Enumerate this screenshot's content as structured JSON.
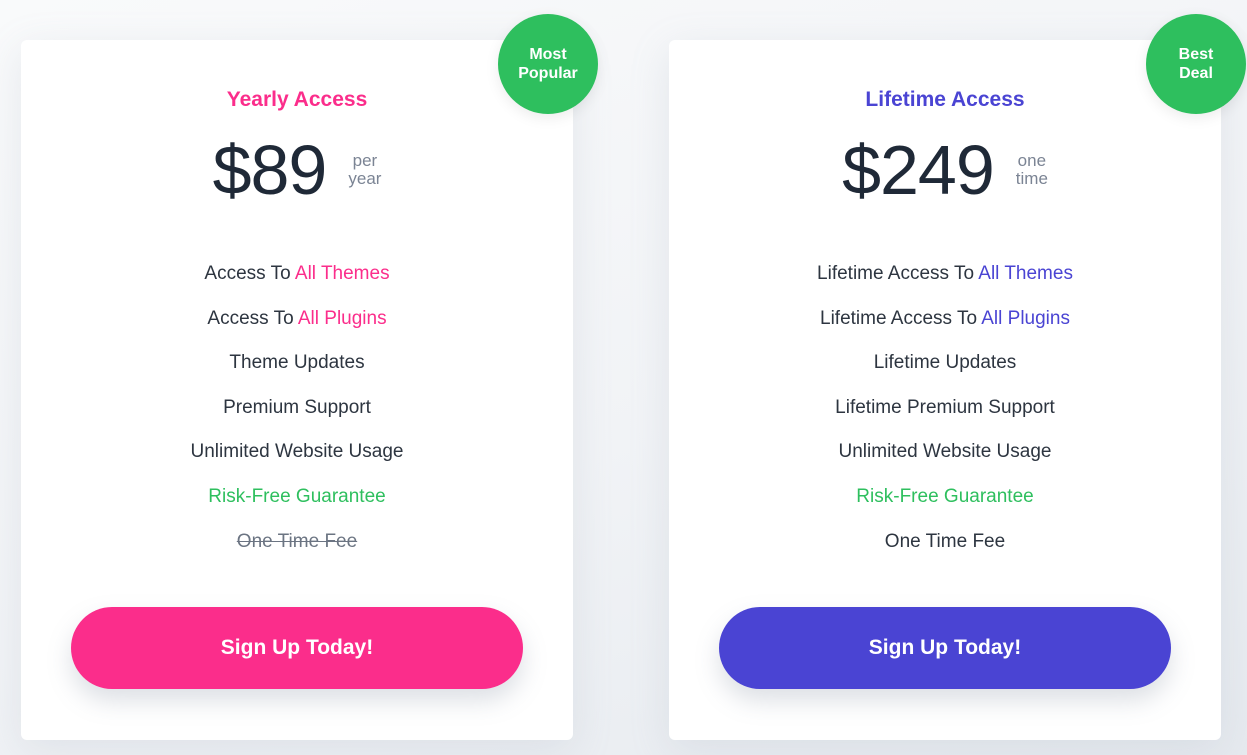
{
  "colors": {
    "yearly_accent": "#fb2d8b",
    "lifetime_accent": "#4a44d3",
    "badge_green": "#2ebf5e",
    "text_dark": "#2d3540"
  },
  "plans": [
    {
      "badge": "Most\nPopular",
      "title": "Yearly Access",
      "price": "$89",
      "period": "per\nyear",
      "features": [
        {
          "prefix": "Access To ",
          "highlight": "All Themes"
        },
        {
          "prefix": "Access To ",
          "highlight": "All Plugins"
        },
        {
          "prefix": "Theme Updates",
          "highlight": ""
        },
        {
          "prefix": "Premium Support",
          "highlight": ""
        },
        {
          "prefix": "Unlimited Website Usage",
          "highlight": ""
        },
        {
          "prefix": "Risk-Free Guarantee",
          "highlight": "",
          "style": "green"
        },
        {
          "prefix": "One Time Fee",
          "highlight": "",
          "style": "strike"
        }
      ],
      "cta": "Sign Up Today!"
    },
    {
      "badge": "Best\nDeal",
      "title": "Lifetime Access",
      "price": "$249",
      "period": "one\ntime",
      "features": [
        {
          "prefix": "Lifetime Access To ",
          "highlight": "All Themes"
        },
        {
          "prefix": "Lifetime Access To ",
          "highlight": "All Plugins"
        },
        {
          "prefix": "Lifetime Updates",
          "highlight": ""
        },
        {
          "prefix": "Lifetime Premium Support",
          "highlight": ""
        },
        {
          "prefix": "Unlimited Website Usage",
          "highlight": ""
        },
        {
          "prefix": "Risk-Free Guarantee",
          "highlight": "",
          "style": "green"
        },
        {
          "prefix": "One Time Fee",
          "highlight": ""
        }
      ],
      "cta": "Sign Up Today!"
    }
  ]
}
